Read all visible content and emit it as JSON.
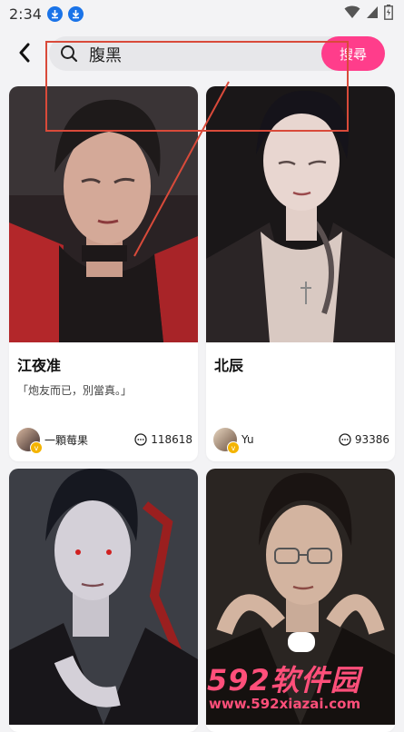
{
  "status": {
    "time": "2:34"
  },
  "search": {
    "query": "腹黑",
    "button_label": "搜尋"
  },
  "cards": [
    {
      "title": "江夜准",
      "description": "「炮友而已，別當真。」",
      "author": "一顆莓果",
      "count": "118618"
    },
    {
      "title": "北辰",
      "description": "",
      "author": "Yu",
      "count": "93386"
    },
    {
      "title": "",
      "description": "",
      "author": "",
      "count": ""
    },
    {
      "title": "",
      "description": "",
      "author": "",
      "count": ""
    }
  ],
  "watermark": {
    "brand": "592软件园",
    "url": "www.592xiazai.com"
  },
  "colors": {
    "accent": "#ff3d8b",
    "annotation": "#d94a3a",
    "badge": "#f4b400"
  }
}
